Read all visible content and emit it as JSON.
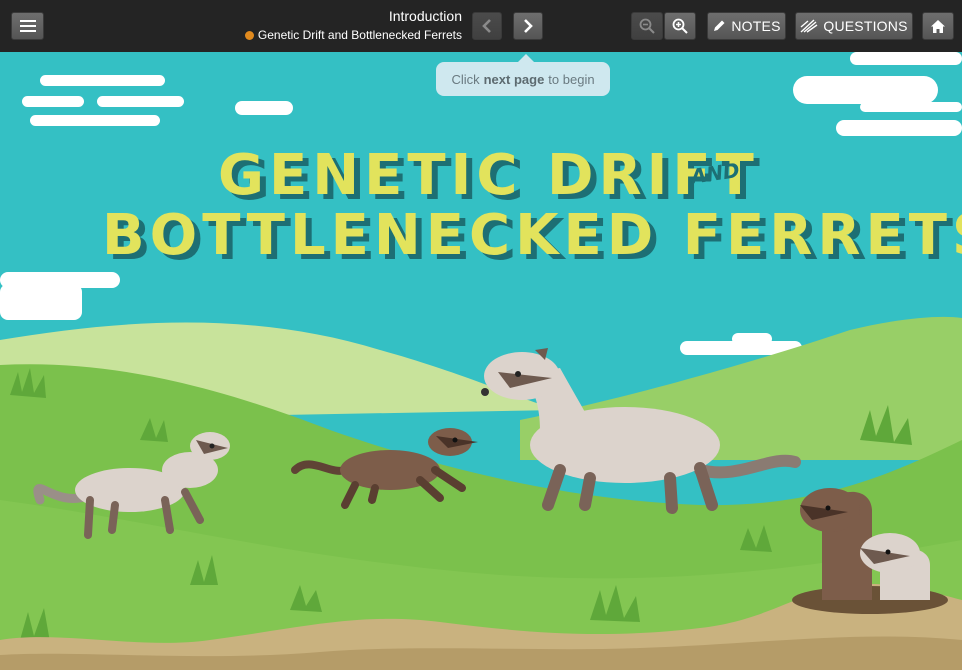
{
  "toolbar": {
    "section_title": "Introduction",
    "lesson_title": "Genetic Drift and Bottlenecked Ferrets",
    "notes_label": "NOTES",
    "questions_label": "QUESTIONS"
  },
  "tooltip": {
    "prefix": "Click",
    "emphasis": "next page",
    "suffix": "to begin"
  },
  "hero": {
    "title_line1": "GENETIC DRIFT",
    "title_and": "AND",
    "title_line2": "BOTTLENECKED FERRETS"
  },
  "colors": {
    "sky": "#34c0c4",
    "title_yellow": "#e2e35c",
    "title_shadow": "#1d6f74",
    "grass": "#7bc14c",
    "ferret_light": "#dcd3cc",
    "ferret_dark": "#7d5d4a"
  }
}
